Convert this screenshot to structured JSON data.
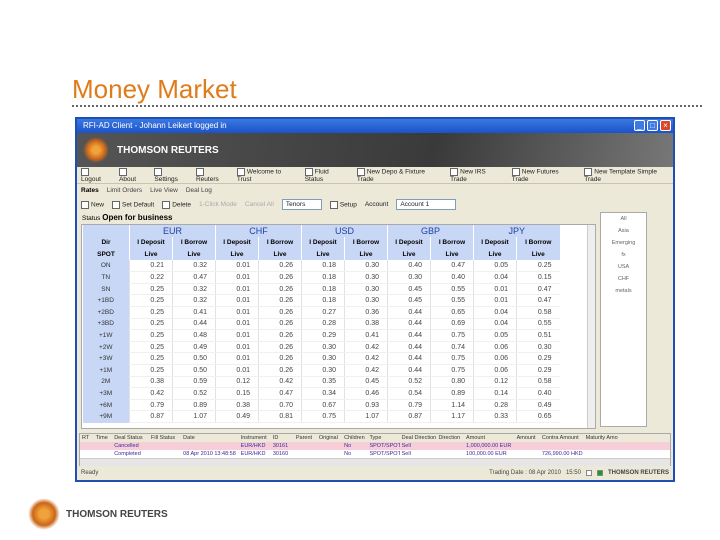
{
  "slide": {
    "title": "Money Market",
    "footer_brand": "THOMSON REUTERS"
  },
  "window": {
    "title": "RFI-AD Client - Johann Leikert logged in",
    "brand": "THOMSON REUTERS"
  },
  "toolbar": [
    "Logout",
    "About",
    "Settings",
    "Reuters",
    "Welcome to Trust",
    "Fluid Status",
    "New Depo & Fixture Trade",
    "New IRS Trade",
    "New Futures Trade",
    "New Template Simple Trade"
  ],
  "tabs": [
    "Rates",
    "Limit Orders",
    "Live View",
    "Deal Log"
  ],
  "actions": {
    "new": "New",
    "set_default": "Set Default",
    "delete": "Delete",
    "click_mode": "1-Click Mode",
    "cancel_all": "Cancel All",
    "tenor_select": "Tenors",
    "setup": "Setup",
    "account_label": "Account",
    "account_value": "Account 1"
  },
  "status": {
    "label": "Status",
    "value": "Open for business"
  },
  "grid": {
    "dir_label": "Dir",
    "spot_label": "SPOT",
    "currencies": [
      "EUR",
      "CHF",
      "USD",
      "GBP",
      "JPY"
    ],
    "sub_headers": [
      "I Deposit",
      "I Borrow"
    ],
    "live_label": "Live",
    "rows": [
      {
        "tenor": "ON",
        "values": [
          "0.21",
          "0.32",
          "0.01",
          "0.26",
          "0.18",
          "0.30",
          "0.40",
          "0.47",
          "0.05",
          "0.25"
        ]
      },
      {
        "tenor": "TN",
        "values": [
          "0.22",
          "0.47",
          "0.01",
          "0.26",
          "0.18",
          "0.30",
          "0.30",
          "0.40",
          "0.04",
          "0.15"
        ]
      },
      {
        "tenor": "SN",
        "values": [
          "0.25",
          "0.32",
          "0.01",
          "0.26",
          "0.18",
          "0.30",
          "0.45",
          "0.55",
          "0.01",
          "0.47"
        ]
      },
      {
        "tenor": "+1BD",
        "values": [
          "0.25",
          "0.32",
          "0.01",
          "0.26",
          "0.18",
          "0.30",
          "0.45",
          "0.55",
          "0.01",
          "0.47"
        ]
      },
      {
        "tenor": "+2BD",
        "values": [
          "0.25",
          "0.41",
          "0.01",
          "0.26",
          "0.27",
          "0.36",
          "0.44",
          "0.65",
          "0.04",
          "0.58"
        ]
      },
      {
        "tenor": "+3BD",
        "values": [
          "0.25",
          "0.44",
          "0.01",
          "0.26",
          "0.28",
          "0.38",
          "0.44",
          "0.69",
          "0.04",
          "0.55"
        ]
      },
      {
        "tenor": "+1W",
        "values": [
          "0.25",
          "0.48",
          "0.01",
          "0.26",
          "0.29",
          "0.41",
          "0.44",
          "0.75",
          "0.05",
          "0.51"
        ]
      },
      {
        "tenor": "+2W",
        "values": [
          "0.25",
          "0.49",
          "0.01",
          "0.26",
          "0.30",
          "0.42",
          "0.44",
          "0.74",
          "0.06",
          "0.30"
        ]
      },
      {
        "tenor": "+3W",
        "values": [
          "0.25",
          "0.50",
          "0.01",
          "0.26",
          "0.30",
          "0.42",
          "0.44",
          "0.75",
          "0.06",
          "0.29"
        ]
      },
      {
        "tenor": "+1M",
        "values": [
          "0.25",
          "0.50",
          "0.01",
          "0.26",
          "0.30",
          "0.42",
          "0.44",
          "0.75",
          "0.06",
          "0.29"
        ]
      },
      {
        "tenor": "2M",
        "values": [
          "0.38",
          "0.59",
          "0.12",
          "0.42",
          "0.35",
          "0.45",
          "0.52",
          "0.80",
          "0.12",
          "0.58"
        ]
      },
      {
        "tenor": "+3M",
        "values": [
          "0.42",
          "0.52",
          "0.15",
          "0.47",
          "0.34",
          "0.46",
          "0.54",
          "0.89",
          "0.14",
          "0.40"
        ]
      },
      {
        "tenor": "+6M",
        "values": [
          "0.79",
          "0.89",
          "0.38",
          "0.70",
          "0.67",
          "0.93",
          "0.79",
          "1.14",
          "0.28",
          "0.49"
        ]
      },
      {
        "tenor": "+9M",
        "values": [
          "0.87",
          "1.07",
          "0.49",
          "0.81",
          "0.75",
          "1.07",
          "0.87",
          "1.17",
          "0.33",
          "0.65"
        ]
      }
    ]
  },
  "side_panel": [
    "All",
    "Asia",
    "Emerging",
    "fx",
    "USA",
    "CHF",
    "metals"
  ],
  "blotter": {
    "headers": [
      "RT",
      "Time",
      "Deal Status",
      "Fill Status",
      "Date",
      "Instrument",
      "ID",
      "Parent",
      "Original",
      "Children",
      "Type",
      "Deal Direction",
      "Direction",
      "Amount",
      "Amount",
      "Contra Amount",
      "Maturity Amo"
    ],
    "rows": [
      [
        "",
        "",
        "Cancelled",
        "",
        "",
        "EUR/HKD",
        "30161",
        "",
        "",
        "No",
        "SPOT/SPOT",
        "Sell",
        "",
        "1,000,000.00 EUR",
        "",
        "",
        ""
      ],
      [
        "",
        "",
        "Completed",
        "",
        "08 Apr 2010 13:48:58",
        "EUR/HKD",
        "30160",
        "",
        "",
        "No",
        "SPOT/SPOT",
        "Sell",
        "",
        "100,000.00 EUR",
        "",
        "726,990.00 HKD",
        ""
      ]
    ]
  },
  "statusbar": {
    "left": "Ready",
    "trading_date": "Trading Date : 08 Apr 2010",
    "time": "15:50",
    "brand": "THOMSON REUTERS"
  }
}
